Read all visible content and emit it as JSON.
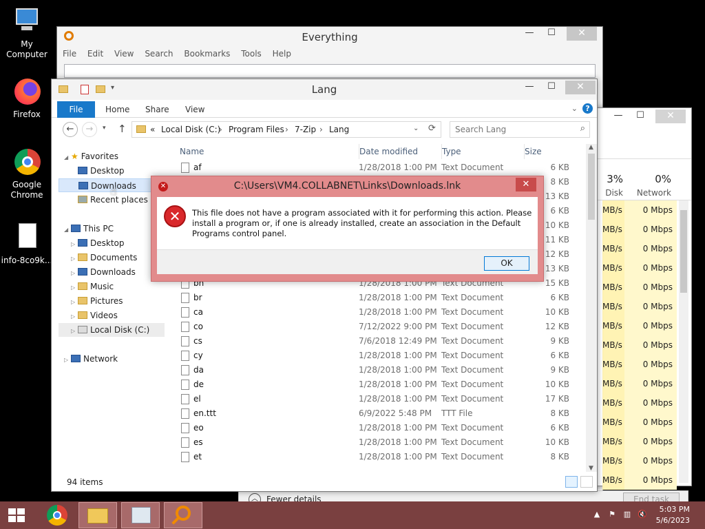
{
  "desktop": {
    "icons": [
      {
        "label": "My Computer"
      },
      {
        "label": "Firefox"
      },
      {
        "label": "Google Chrome"
      },
      {
        "label": "info-8co9k..."
      }
    ]
  },
  "everything": {
    "title": "Everything",
    "menu": [
      "File",
      "Edit",
      "View",
      "Search",
      "Bookmarks",
      "Tools",
      "Help"
    ],
    "search_value": ""
  },
  "taskmgr": {
    "disk_pct": "3%",
    "disk_label": "Disk",
    "net_pct": "0%",
    "net_label": "Network",
    "rows": [
      {
        "disk": "MB/s",
        "net": "0 Mbps"
      },
      {
        "disk": "MB/s",
        "net": "0 Mbps"
      },
      {
        "disk": "MB/s",
        "net": "0 Mbps"
      },
      {
        "disk": "MB/s",
        "net": "0 Mbps"
      },
      {
        "disk": "MB/s",
        "net": "0 Mbps"
      },
      {
        "disk": "MB/s",
        "net": "0 Mbps"
      },
      {
        "disk": "MB/s",
        "net": "0 Mbps"
      },
      {
        "disk": "MB/s",
        "net": "0 Mbps"
      },
      {
        "disk": "MB/s",
        "net": "0 Mbps"
      },
      {
        "disk": "MB/s",
        "net": "0 Mbps"
      },
      {
        "disk": "MB/s",
        "net": "0 Mbps"
      },
      {
        "disk": "MB/s",
        "net": "0 Mbps"
      },
      {
        "disk": "MB/s",
        "net": "0 Mbps"
      },
      {
        "disk": "MB/s",
        "net": "0 Mbps"
      },
      {
        "disk": "MB/s",
        "net": "0 Mbps"
      }
    ],
    "fewer_details": "Fewer details",
    "end_task": "End task"
  },
  "explorer": {
    "title": "Lang",
    "ribbon_tabs": [
      "File",
      "Home",
      "Share",
      "View"
    ],
    "address": {
      "prefix": "«",
      "parts": [
        "Local Disk (C:)",
        "Program Files",
        "7-Zip",
        "Lang"
      ]
    },
    "search_placeholder": "Search Lang",
    "nav": {
      "favorites": "Favorites",
      "fav_items": [
        "Desktop",
        "Downloads",
        "Recent places"
      ],
      "this_pc": "This PC",
      "pc_items": [
        "Desktop",
        "Documents",
        "Downloads",
        "Music",
        "Pictures",
        "Videos",
        "Local Disk (C:)"
      ],
      "network": "Network"
    },
    "columns": {
      "name": "Name",
      "date": "Date modified",
      "type": "Type",
      "size": "Size"
    },
    "files": [
      {
        "name": "af",
        "date": "1/28/2018 1:00 PM",
        "type": "Text Document",
        "size": "6 KB"
      },
      {
        "name": "",
        "date": "",
        "type": "",
        "size": "8 KB"
      },
      {
        "name": "",
        "date": "",
        "type": "",
        "size": "13 KB"
      },
      {
        "name": "",
        "date": "",
        "type": "",
        "size": "6 KB"
      },
      {
        "name": "",
        "date": "",
        "type": "",
        "size": "10 KB"
      },
      {
        "name": "",
        "date": "",
        "type": "",
        "size": "11 KB"
      },
      {
        "name": "",
        "date": "",
        "type": "",
        "size": "12 KB"
      },
      {
        "name": "",
        "date": "",
        "type": "",
        "size": "13 KB"
      },
      {
        "name": "bn",
        "date": "1/28/2018 1:00 PM",
        "type": "Text Document",
        "size": "15 KB"
      },
      {
        "name": "br",
        "date": "1/28/2018 1:00 PM",
        "type": "Text Document",
        "size": "6 KB"
      },
      {
        "name": "ca",
        "date": "1/28/2018 1:00 PM",
        "type": "Text Document",
        "size": "10 KB"
      },
      {
        "name": "co",
        "date": "7/12/2022 9:00 PM",
        "type": "Text Document",
        "size": "12 KB"
      },
      {
        "name": "cs",
        "date": "7/6/2018 12:49 PM",
        "type": "Text Document",
        "size": "9 KB"
      },
      {
        "name": "cy",
        "date": "1/28/2018 1:00 PM",
        "type": "Text Document",
        "size": "6 KB"
      },
      {
        "name": "da",
        "date": "1/28/2018 1:00 PM",
        "type": "Text Document",
        "size": "9 KB"
      },
      {
        "name": "de",
        "date": "1/28/2018 1:00 PM",
        "type": "Text Document",
        "size": "10 KB"
      },
      {
        "name": "el",
        "date": "1/28/2018 1:00 PM",
        "type": "Text Document",
        "size": "17 KB"
      },
      {
        "name": "en.ttt",
        "date": "6/9/2022 5:48 PM",
        "type": "TTT File",
        "size": "8 KB"
      },
      {
        "name": "eo",
        "date": "1/28/2018 1:00 PM",
        "type": "Text Document",
        "size": "6 KB"
      },
      {
        "name": "es",
        "date": "1/28/2018 1:00 PM",
        "type": "Text Document",
        "size": "10 KB"
      },
      {
        "name": "et",
        "date": "1/28/2018 1:00 PM",
        "type": "Text Document",
        "size": "8 KB"
      }
    ],
    "status": "94 items"
  },
  "dialog": {
    "title": "C:\\Users\\VM4.COLLABNET\\Links\\Downloads.lnk",
    "message": "This file does not have a program associated with it for performing this action. Please install a program or, if one is already installed, create an association in the Default Programs control panel.",
    "ok": "OK"
  },
  "taskbar": {
    "time": "5:03 PM",
    "date": "5/6/2023"
  },
  "colors": {
    "dialog_frame": "#e28b8c",
    "taskbar": "#7a4040",
    "ribbon_file": "#1979ca"
  }
}
